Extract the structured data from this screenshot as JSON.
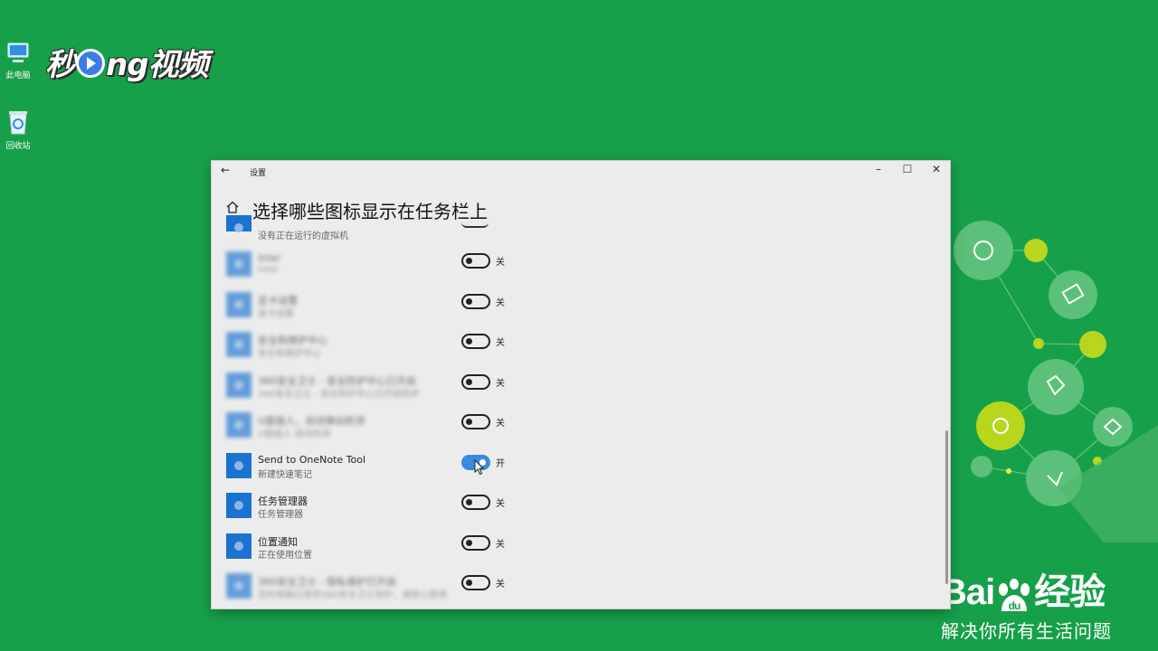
{
  "desktop": {
    "icons": [
      {
        "label": "此电脑",
        "icon": "computer-icon"
      },
      {
        "label": "回收站",
        "icon": "recycle-bin-icon"
      }
    ],
    "watermark_brand": "秒dng视频",
    "baidu": {
      "brand": "Bai",
      "brand2": "经验",
      "slogan": "解决你所有生活问题"
    }
  },
  "window": {
    "title": "设置",
    "page_title": "选择哪些图标显示在任务栏上",
    "controls": {
      "minimize": "–",
      "maximize": "☐",
      "close": "✕"
    },
    "rows": [
      {
        "name": "",
        "sub": "没有正在运行的虚拟机",
        "state": "",
        "on": false,
        "blurred": false
      },
      {
        "name": "Intel",
        "sub": "Intel",
        "state": "关",
        "on": false,
        "blurred": true
      },
      {
        "name": "显卡设置",
        "sub": "显卡设置",
        "state": "关",
        "on": false,
        "blurred": true
      },
      {
        "name": "安全和维护中心",
        "sub": "安全和维护中心",
        "state": "关",
        "on": false,
        "blurred": true
      },
      {
        "name": "360安全卫士 - 安全防护中心已开启",
        "sub": "360安全卫士 - 安全防护中心已开启防护",
        "state": "关",
        "on": false,
        "blurred": true
      },
      {
        "name": "U盘插入，自动弹出检测",
        "sub": "U盘插入 自动检测",
        "state": "关",
        "on": false,
        "blurred": true
      },
      {
        "name": "Send to OneNote Tool",
        "sub": "新建快速笔记",
        "state": "开",
        "on": true,
        "blurred": false
      },
      {
        "name": "任务管理器",
        "sub": "任务管理器",
        "state": "关",
        "on": false,
        "blurred": false
      },
      {
        "name": "位置通知",
        "sub": "正在使用位置",
        "state": "关",
        "on": false,
        "blurred": false
      },
      {
        "name": "360安全卫士 - 隐私保护已开启",
        "sub": "您的电脑已受到360安全卫士保护，请放心使用",
        "state": "关",
        "on": false,
        "blurred": true
      }
    ]
  },
  "colors": {
    "desktop_bg": "#17a04a",
    "accent": "#1a73d1",
    "toggle_on": "#3a8be0"
  }
}
